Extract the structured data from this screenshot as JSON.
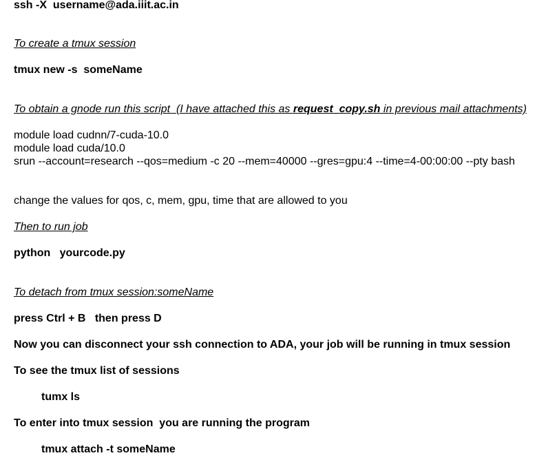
{
  "ssh_command": "ssh -X  username@ada.iiit.ac.in",
  "heading_create_session": "To create a tmux session",
  "tmux_new_command": "tmux new -s  someName",
  "gnode_heading": {
    "prefix": "To obtain a gnode run this script  (I have attached this as ",
    "filename_part1": "request",
    "filename_separator": "_",
    "filename_part2": "copy.sh",
    "suffix": " in previous mail attachments)"
  },
  "script_lines": [
    "module load cudnn/7-cuda-10.0",
    "module load cuda/10.0",
    "srun --account=research --qos=medium -c 20 --mem=40000 --gres=gpu:4 --time=4-00:00:00 --pty bash"
  ],
  "change_values_note": "change the values for qos, c, mem, gpu, time that are allowed to you",
  "heading_run_job": "Then to run job",
  "python_command": "python   yourcode.py",
  "heading_detach": "To detach from tmux session:someName",
  "detach_keys": "press Ctrl + B   then press D",
  "disconnect_note": "Now you can disconnect your ssh connection to ADA, your job will be running in tmux session",
  "list_sessions_heading": "To see the tmux list of sessions",
  "list_sessions_command": "tumx ls",
  "enter_session_heading": "To enter into tmux session  you are running the program",
  "attach_command": "tmux attach -t someName"
}
